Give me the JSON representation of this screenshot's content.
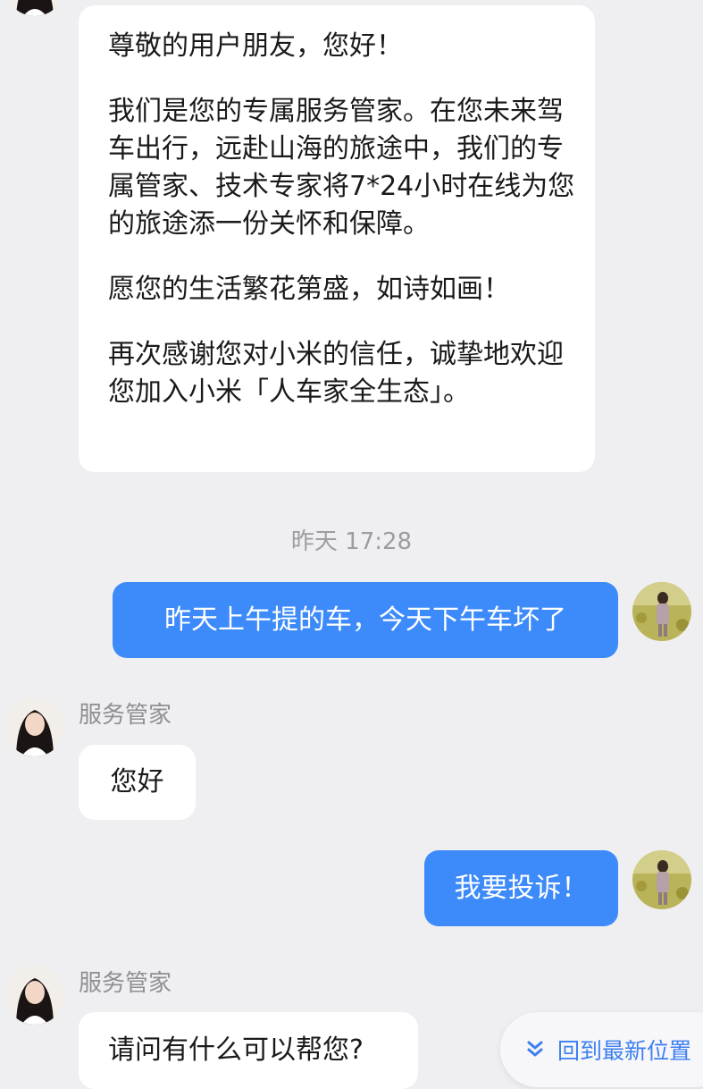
{
  "welcome_message": {
    "lines": [
      "尊敬的用户朋友，您好！",
      "我们是您的专属服务管家。在您未来驾车出行，远赴山海的旅途中，我们的专属管家、技术专家将7*24小时在线为您的旅途添一份关怀和保障。",
      "愿您的生活繁花第盛，如诗如画！",
      "再次感谢您对小米的信任，诚挚地欢迎您加入小米「人车家全生态」。"
    ]
  },
  "timestamp": "昨天 17:28",
  "messages": [
    {
      "from": "user",
      "text": "昨天上午提的车，今天下午车坏了"
    },
    {
      "from": "agent",
      "sender": "服务管家",
      "text": "您好"
    },
    {
      "from": "user",
      "text": "我要投诉！"
    },
    {
      "from": "agent",
      "sender": "服务管家",
      "text": "请问有什么可以帮您?"
    }
  ],
  "jump_button": {
    "icon": "double-chevron-down-icon",
    "label": "回到最新位置"
  },
  "colors": {
    "accent": "#3d8afa",
    "background": "#efeff1",
    "bubble_in": "#ffffff"
  }
}
